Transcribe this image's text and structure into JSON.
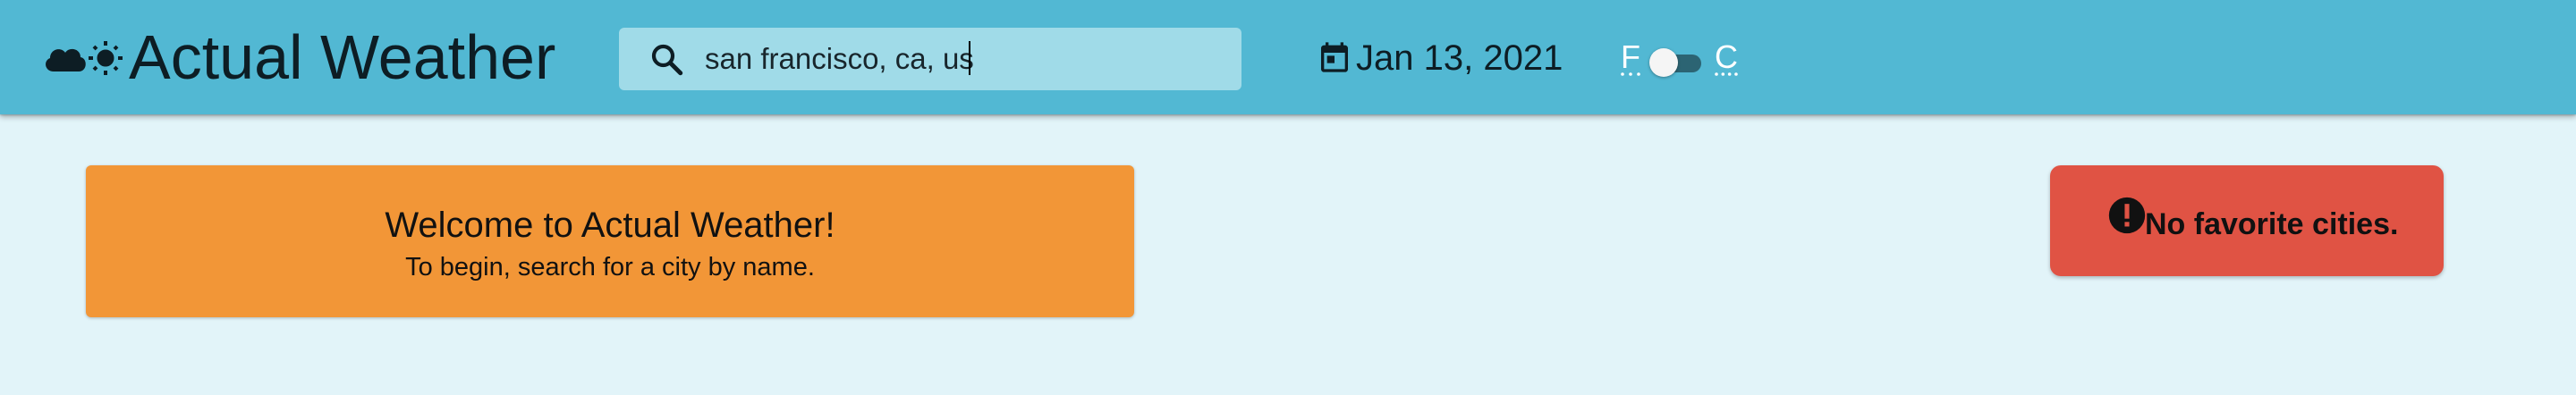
{
  "app": {
    "title": "Actual Weather",
    "icons": [
      "cloud-icon",
      "sun-icon"
    ]
  },
  "search": {
    "value": "san francisco, ca, us",
    "icon": "search-icon"
  },
  "date": {
    "icon": "calendar-icon",
    "text": "Jan 13, 2021"
  },
  "units": {
    "left_label": "F",
    "right_label": "C",
    "toggle_on": false
  },
  "welcome": {
    "title": "Welcome to Actual Weather!",
    "subtitle": "To begin, search for a city by name."
  },
  "favorites": {
    "icon": "alert-icon",
    "message": "No favorite cities."
  },
  "colors": {
    "appbar": "#52b8d3",
    "background": "#e2f4f9",
    "welcome_card": "#f29637",
    "alert_card": "#e05344"
  }
}
